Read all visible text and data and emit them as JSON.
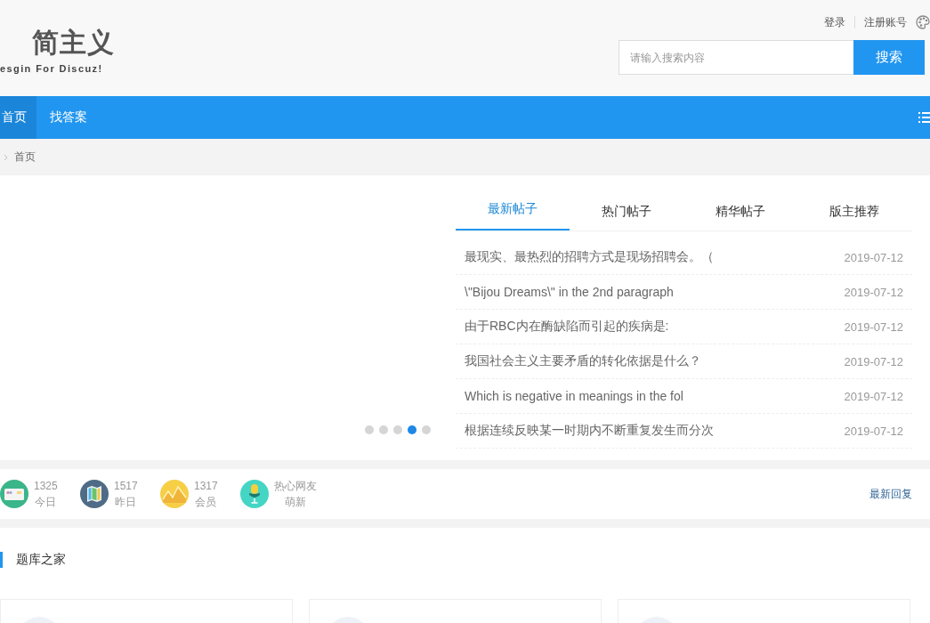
{
  "header": {
    "logo_title": "简主义",
    "logo_subtitle": "esgin For Discuz!",
    "user_links": [
      "登录",
      "注册账号"
    ],
    "search": {
      "placeholder": "请输入搜索内容",
      "button": "搜索"
    }
  },
  "nav": {
    "items": [
      {
        "label": "首页",
        "selected": true
      },
      {
        "label": "找答案",
        "selected": false
      }
    ]
  },
  "breadcrumb": [
    "首页"
  ],
  "carousel": {
    "dots": [
      {
        "selected": false
      },
      {
        "selected": false
      },
      {
        "selected": false
      },
      {
        "selected": true
      },
      {
        "selected": false
      }
    ]
  },
  "posts": {
    "tabs": [
      {
        "label": "最新帖子",
        "selected": true
      },
      {
        "label": "热门帖子",
        "selected": false
      },
      {
        "label": "精华帖子",
        "selected": false
      },
      {
        "label": "版主推荐",
        "selected": false
      }
    ],
    "rows": [
      {
        "title": "最现实、最热烈的招聘方式是现场招聘会。（",
        "date": "2019-07-12"
      },
      {
        "title": "\\\"Bijou Dreams\\\" in the 2nd paragraph",
        "date": "2019-07-12"
      },
      {
        "title": "由于RBC内在酶缺陷而引起的疾病是:",
        "date": "2019-07-12"
      },
      {
        "title": "我国社会主义主要矛盾的转化依据是什么？",
        "date": "2019-07-12"
      },
      {
        "title": "Which is negative in meanings in the fol",
        "date": "2019-07-12"
      },
      {
        "title": "根据连续反映某一时期内不断重复发生而分次",
        "date": "2019-07-12"
      }
    ]
  },
  "stats": {
    "items": [
      {
        "value": "1325",
        "label": "今日"
      },
      {
        "value": "1517",
        "label": "昨日"
      },
      {
        "value": "1317",
        "label": "会员"
      },
      {
        "value": "热心网友",
        "label": "萌新"
      }
    ],
    "latest_link": "最新回复"
  },
  "section": {
    "title": "题库之家"
  }
}
